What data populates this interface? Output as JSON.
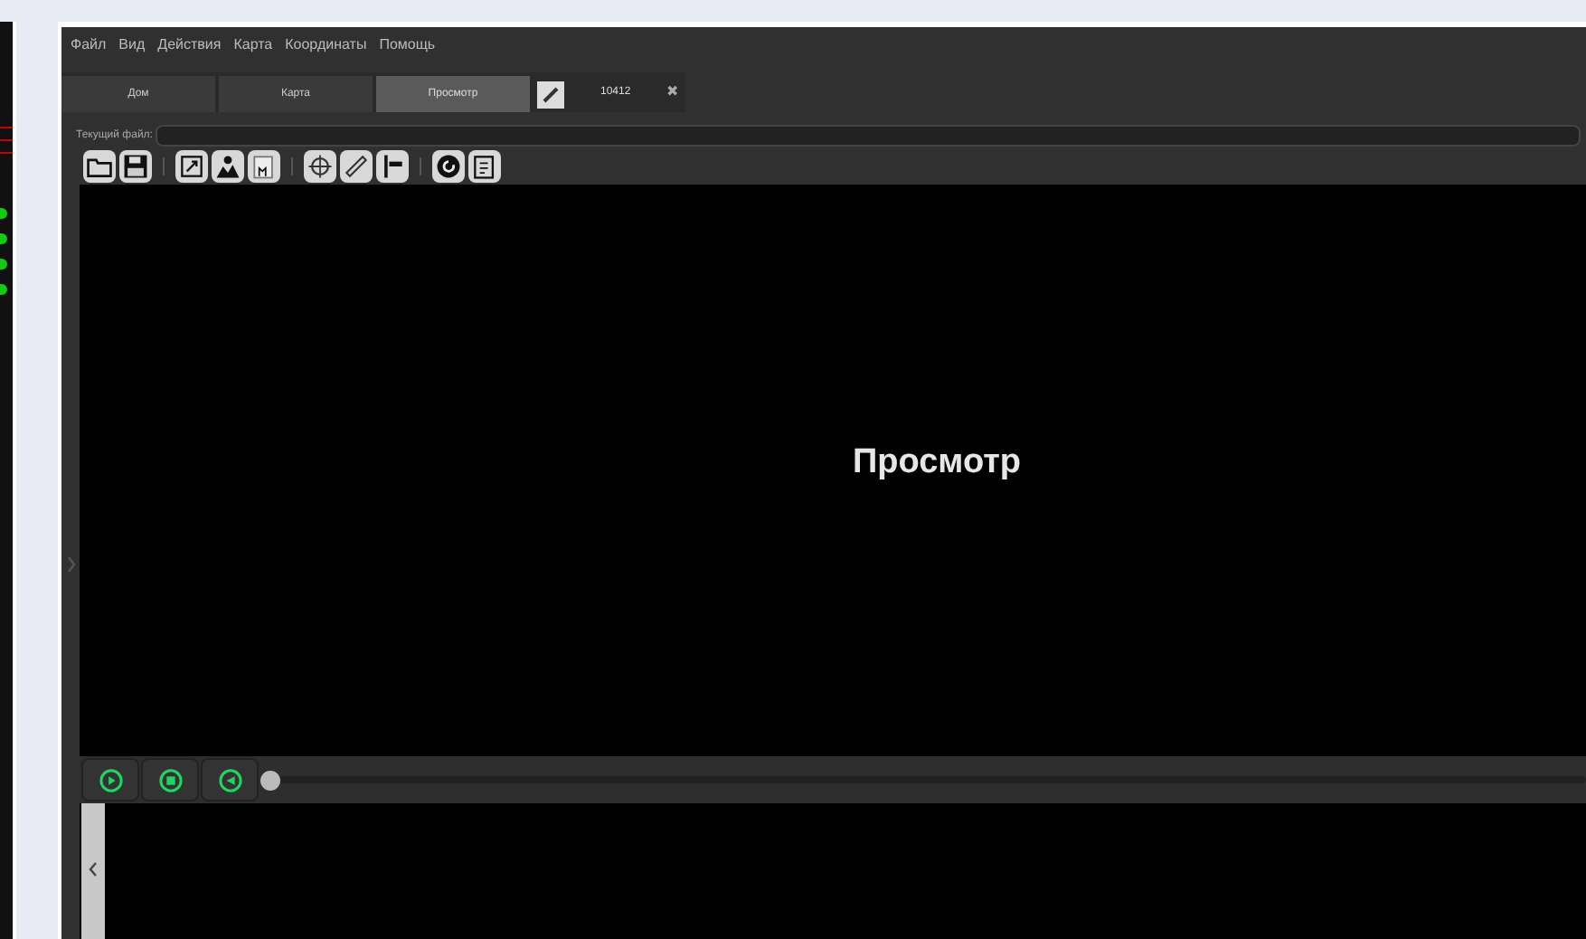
{
  "menu": [
    "Файл",
    "Вид",
    "Действия",
    "Карта",
    "Координаты",
    "Помощь"
  ],
  "tabs": [
    {
      "label": "Дом",
      "selected": false
    },
    {
      "label": "Карта",
      "selected": false
    },
    {
      "label": "Просмотр",
      "selected": true
    }
  ],
  "document_tab": {
    "label": "10412",
    "close": "✖"
  },
  "current_file": {
    "label": "Текущий файл:"
  },
  "viewer": {
    "title": "Просмотр"
  },
  "playback": {
    "level": 0
  }
}
